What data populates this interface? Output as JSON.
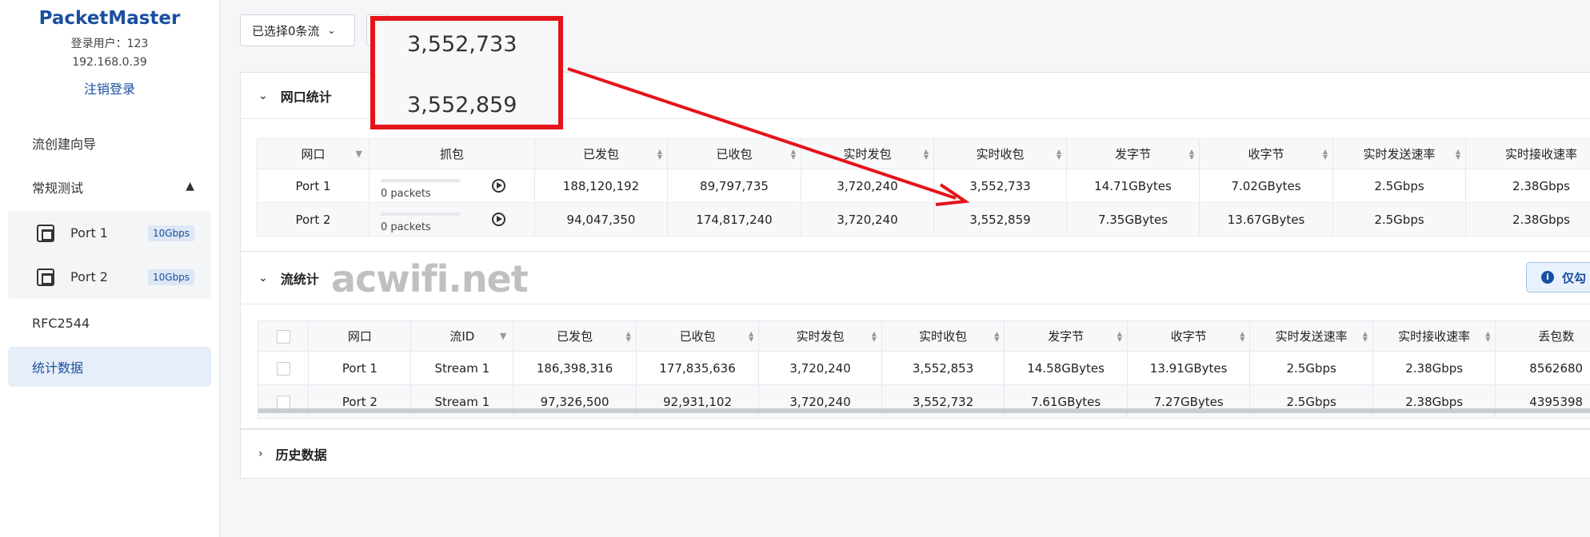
{
  "sidebar": {
    "brand": "PacketMaster",
    "user_line": "登录用户：123",
    "ip": "192.168.0.39",
    "logout": "注销登录",
    "nav_wizard": "流创建向导",
    "nav_regular": "常规测试",
    "ports": [
      {
        "label": "Port 1",
        "speed": "10Gbps"
      },
      {
        "label": "Port 2",
        "speed": "10Gbps"
      }
    ],
    "nav_rfc": "RFC2544",
    "nav_stats": "统计数据"
  },
  "toolbar": {
    "select_label": "已选择0条流"
  },
  "callout": {
    "value1": "3,552,733",
    "value2": "3,552,859"
  },
  "port_stats": {
    "title": "网口统计",
    "headers": [
      "网口",
      "抓包",
      "已发包",
      "已收包",
      "实时发包",
      "实时收包",
      "发字节",
      "收字节",
      "实时发送速率",
      "实时接收速率"
    ],
    "rows": [
      {
        "port": "Port 1",
        "capture": "0 packets",
        "sent": "188,120,192",
        "received": "89,797,735",
        "rt_sent": "3,720,240",
        "rt_recv": "3,552,733",
        "tx_bytes": "14.71GBytes",
        "rx_bytes": "7.02GBytes",
        "tx_rate": "2.5Gbps",
        "rx_rate": "2.38Gbps"
      },
      {
        "port": "Port 2",
        "capture": "0 packets",
        "sent": "94,047,350",
        "received": "174,817,240",
        "rt_sent": "3,720,240",
        "rt_recv": "3,552,859",
        "tx_bytes": "7.35GBytes",
        "rx_bytes": "13.67GBytes",
        "tx_rate": "2.5Gbps",
        "rx_rate": "2.38Gbps"
      }
    ]
  },
  "flow_stats": {
    "title": "流统计",
    "info_label": "仅勾",
    "headers": [
      "网口",
      "流ID",
      "已发包",
      "已收包",
      "实时发包",
      "实时收包",
      "发字节",
      "收字节",
      "实时发送速率",
      "实时接收速率",
      "丢包数"
    ],
    "rows": [
      {
        "port": "Port 1",
        "stream": "Stream 1",
        "sent": "186,398,316",
        "received": "177,835,636",
        "rt_sent": "3,720,240",
        "rt_recv": "3,552,853",
        "tx_bytes": "14.58GBytes",
        "rx_bytes": "13.91GBytes",
        "tx_rate": "2.5Gbps",
        "rx_rate": "2.38Gbps",
        "loss": "8562680"
      },
      {
        "port": "Port 2",
        "stream": "Stream 1",
        "sent": "97,326,500",
        "received": "92,931,102",
        "rt_sent": "3,720,240",
        "rt_recv": "3,552,732",
        "tx_bytes": "7.61GBytes",
        "rx_bytes": "7.27GBytes",
        "tx_rate": "2.5Gbps",
        "rx_rate": "2.38Gbps",
        "loss": "4395398"
      }
    ]
  },
  "history": {
    "title": "历史数据"
  },
  "watermark": "acwifi.net",
  "colors": {
    "brand": "#1a4fa0",
    "callout_border": "#e5141b",
    "active_nav_bg": "#e6eef9"
  }
}
